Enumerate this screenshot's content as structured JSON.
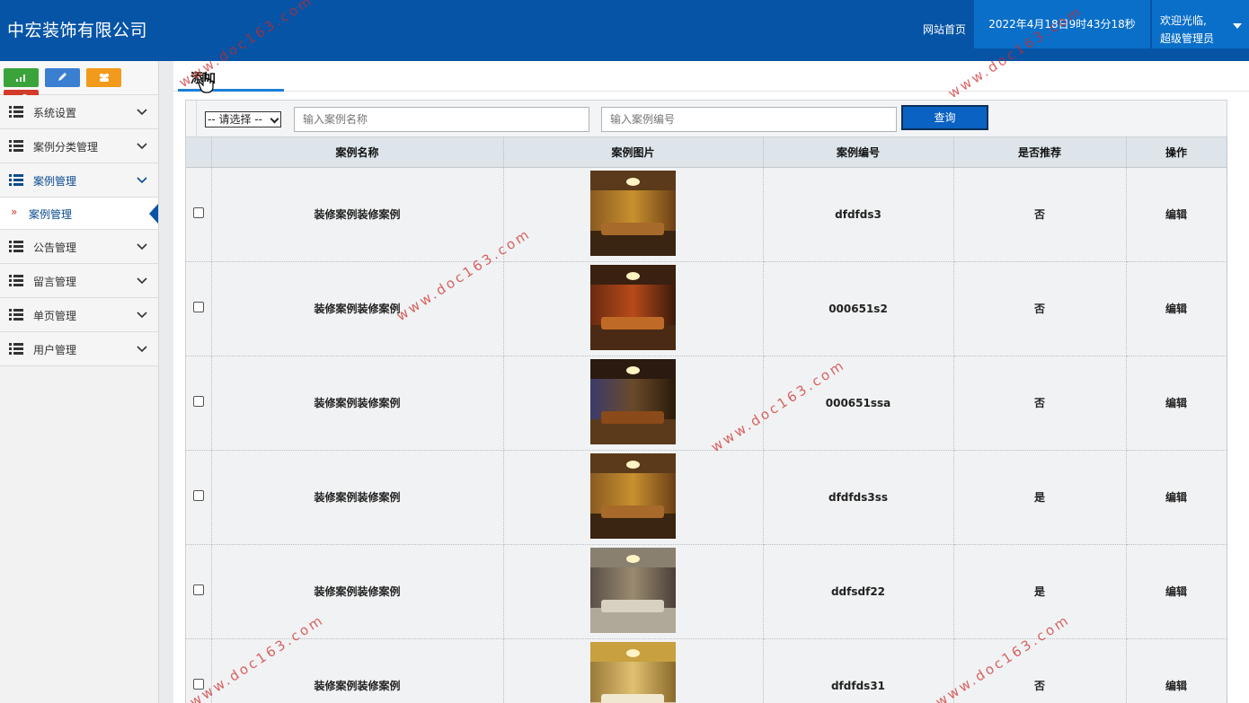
{
  "header": {
    "brand": "中宏装饰有限公司",
    "home_link": "网站首页",
    "datetime": "2022年4月18日9时43分18秒",
    "welcome": "欢迎光临,",
    "user_role": "超级管理员"
  },
  "sidebar": {
    "quick_buttons": [
      {
        "icon": "chart-icon",
        "color": "#3aa33a"
      },
      {
        "icon": "pencil-icon",
        "color": "#3a7fd0"
      },
      {
        "icon": "users-icon",
        "color": "#f29a1b"
      },
      {
        "icon": "cogs-icon",
        "color": "#d43a2a"
      }
    ],
    "items": [
      {
        "label": "系统设置"
      },
      {
        "label": "案例分类管理"
      },
      {
        "label": "案例管理"
      },
      {
        "label": "公告管理"
      },
      {
        "label": "留言管理"
      },
      {
        "label": "单页管理"
      },
      {
        "label": "用户管理"
      }
    ],
    "active_submenu": "案例管理"
  },
  "tabs": {
    "add_label": "添加"
  },
  "search": {
    "select_value": "-- 请选择 --",
    "name_placeholder": "输入案例名称",
    "code_placeholder": "输入案例编号",
    "query_label": "查询"
  },
  "table": {
    "headers": {
      "name": "案例名称",
      "image": "案例图片",
      "code": "案例编号",
      "recommend": "是否推荐",
      "action": "操作"
    },
    "rows": [
      {
        "name": "装修案例装修案例",
        "code": "dfdfds3",
        "recommend": "否",
        "action": "编辑"
      },
      {
        "name": "装修案例装修案例",
        "code": "000651s2",
        "recommend": "否",
        "action": "编辑"
      },
      {
        "name": "装修案例装修案例",
        "code": "000651ssa",
        "recommend": "否",
        "action": "编辑"
      },
      {
        "name": "装修案例装修案例",
        "code": "dfdfds3ss",
        "recommend": "是",
        "action": "编辑"
      },
      {
        "name": "装修案例装修案例",
        "code": "ddfsdf22",
        "recommend": "是",
        "action": "编辑"
      },
      {
        "name": "装修案例装修案例",
        "code": "dfdfds31",
        "recommend": "否",
        "action": "编辑"
      }
    ]
  },
  "watermark": "www.doc163.com",
  "colors": {
    "header_bg": "#0654a6",
    "accent": "#0a62c2"
  }
}
